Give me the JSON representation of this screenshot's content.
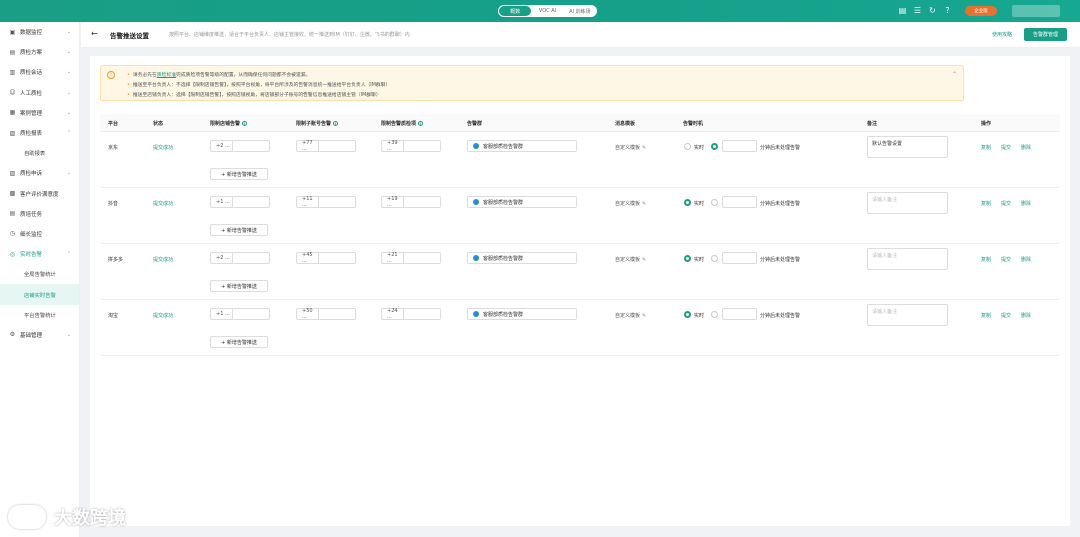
{
  "topbar": {
    "modes": [
      "概数",
      "VOC AI",
      "AI 训练场"
    ],
    "active_mode": 0,
    "icons": [
      "doc-icon",
      "list-icon",
      "refresh-icon",
      "help-icon"
    ],
    "vip_label": "企业版"
  },
  "sidebar": {
    "items": [
      {
        "icon": "▣",
        "label": "数据监控",
        "chev": "⌄"
      },
      {
        "icon": "▤",
        "label": "质检方案",
        "chev": "⌄"
      },
      {
        "icon": "▥",
        "label": "质检会话",
        "chev": "⌄"
      },
      {
        "icon": "☺",
        "label": "人工质检",
        "chev": "⌄"
      },
      {
        "icon": "▦",
        "label": "案例管理",
        "chev": "⌄"
      },
      {
        "icon": "▧",
        "label": "质检报表",
        "chev": "⌃"
      },
      {
        "icon": "",
        "label": "自助报表",
        "sub": true
      },
      {
        "icon": "▨",
        "label": "质检申诉",
        "chev": "⌄"
      },
      {
        "icon": "▩",
        "label": "客户评价满意度"
      },
      {
        "icon": "▤",
        "label": "质培任务"
      },
      {
        "icon": "◷",
        "label": "细长监控"
      },
      {
        "icon": "◎",
        "label": "实时告警",
        "chev": "⌃",
        "open": true
      },
      {
        "icon": "",
        "label": "全局告警统计",
        "sub": true
      },
      {
        "icon": "",
        "label": "店铺实时告警",
        "sub": true,
        "selected": true
      },
      {
        "icon": "",
        "label": "平台告警统计",
        "sub": true
      },
      {
        "icon": "⚙",
        "label": "基础管理",
        "chev": "⌄"
      }
    ]
  },
  "header": {
    "title": "告警推送设置",
    "desc": "按照平台、店铺维度推送，适合于平台负责人、店铺主管接收。统一推送到IM（钉钉、企微、飞书的群聊）内",
    "help_link": "使用攻略",
    "group_button": "告警群管理"
  },
  "notice": {
    "line1_pre": "请务必先在",
    "line1_link": "质检标准",
    "line1_post": "完成质检项告警等级的配置，从而确保任何问题都不会被遗漏。",
    "line2": "推送至平台负责人：不选择【限制店铺告警】，按照平台视角，将平台所涉及的告警消息统一推送给平台负责人（IM群聊）",
    "line3": "推送至店铺负责人：选择【限制店铺告警】，按照店铺视角，将店铺部分子账号的告警信息推送给店铺主管（IM群聊）"
  },
  "table": {
    "headers": {
      "platform": "平台",
      "status": "状态",
      "shop_alert": "限制店铺告警",
      "sub_alert": "限制子账号告警",
      "item_alert": "限制告警质检项",
      "group": "告警群",
      "template": "消息模板",
      "timing": "告警时机",
      "remark": "备注",
      "ops": "操作"
    },
    "add_label": "+ 新增告警推送",
    "realtime_label": "实时",
    "minute_label": "分钟后未处理告警",
    "template_label": "自定义模板",
    "ops": [
      "复制",
      "提交",
      "删除"
    ],
    "remark_placeholder": "请输入备注",
    "rows": [
      {
        "platform": "京东",
        "status": "提交成功",
        "shop": "+2 ...",
        "sub": "+77 ...",
        "item": "+39 ...",
        "group": "客服部质检告警群",
        "realtime": false,
        "remark": "默认告警设置"
      },
      {
        "platform": "抖音",
        "status": "提交成功",
        "shop": "+1 ...",
        "sub": "+11 ...",
        "item": "+19 ...",
        "group": "客服部质检告警群",
        "realtime": true,
        "remark": ""
      },
      {
        "platform": "拼多多",
        "status": "提交成功",
        "shop": "+2 ...",
        "sub": "+45 ...",
        "item": "+21 ...",
        "group": "客服部质检告警群",
        "realtime": true,
        "remark": ""
      },
      {
        "platform": "淘宝",
        "status": "提交成功",
        "shop": "+1 ...",
        "sub": "+50 ...",
        "item": "+24 ...",
        "group": "客服部质检告警群",
        "realtime": true,
        "remark": ""
      }
    ]
  },
  "watermark": "大数跨境",
  "colors": {
    "accent": "#17a086",
    "warning": "#f29a1e",
    "vip": "#e8712d"
  }
}
